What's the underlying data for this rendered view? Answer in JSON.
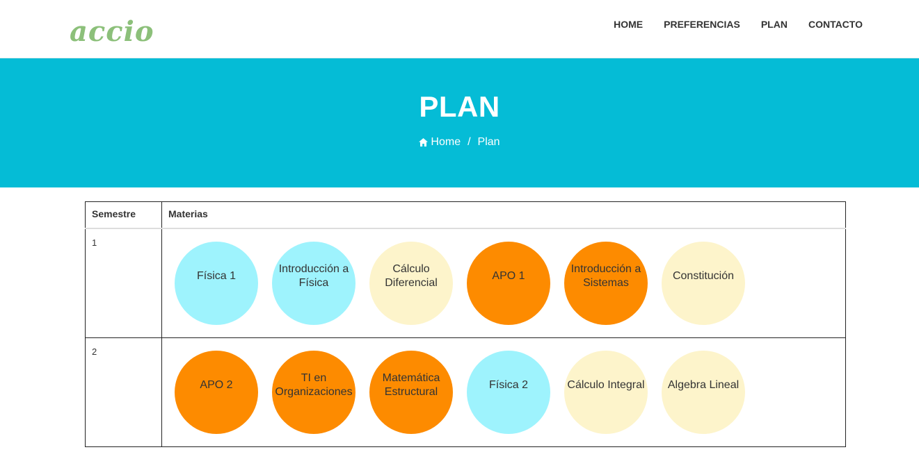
{
  "brand": {
    "logo_text": "accio"
  },
  "nav": {
    "items": [
      {
        "label": "HOME"
      },
      {
        "label": "PREFERENCIAS"
      },
      {
        "label": "PLAN"
      },
      {
        "label": "CONTACTO"
      }
    ]
  },
  "hero": {
    "title": "PLAN",
    "breadcrumb": {
      "home": "Home",
      "separator": "/",
      "current": "Plan"
    },
    "background": "#05bcd6"
  },
  "table": {
    "headers": {
      "semestre": "Semestre",
      "materias": "Materias"
    },
    "rows": [
      {
        "semestre": "1",
        "materias": [
          {
            "name": "Física 1",
            "color": "#9ef3fd"
          },
          {
            "name": "Introducción a Física",
            "color": "#9ef3fd"
          },
          {
            "name": "Cálculo Diferencial",
            "color": "#fdf4cb"
          },
          {
            "name": "APO 1",
            "color": "#fd8b00"
          },
          {
            "name": "Introducción a Sistemas",
            "color": "#fd8b00"
          },
          {
            "name": "Constitución",
            "color": "#fdf4cb"
          }
        ]
      },
      {
        "semestre": "2",
        "materias": [
          {
            "name": "APO 2",
            "color": "#fd8b00"
          },
          {
            "name": "TI en Organizaciones",
            "color": "#fd8b00"
          },
          {
            "name": "Matemática Estructural",
            "color": "#fd8b00"
          },
          {
            "name": "Física 2",
            "color": "#9ef3fd"
          },
          {
            "name": "Cálculo Integral",
            "color": "#fdf4cb"
          },
          {
            "name": "Algebra Lineal",
            "color": "#fdf4cb"
          }
        ]
      }
    ]
  },
  "colors": {
    "logo": "#8cc07a",
    "hero": "#05bcd6",
    "cyan": "#9ef3fd",
    "orange": "#fd8b00",
    "cream": "#fdf4cb"
  }
}
